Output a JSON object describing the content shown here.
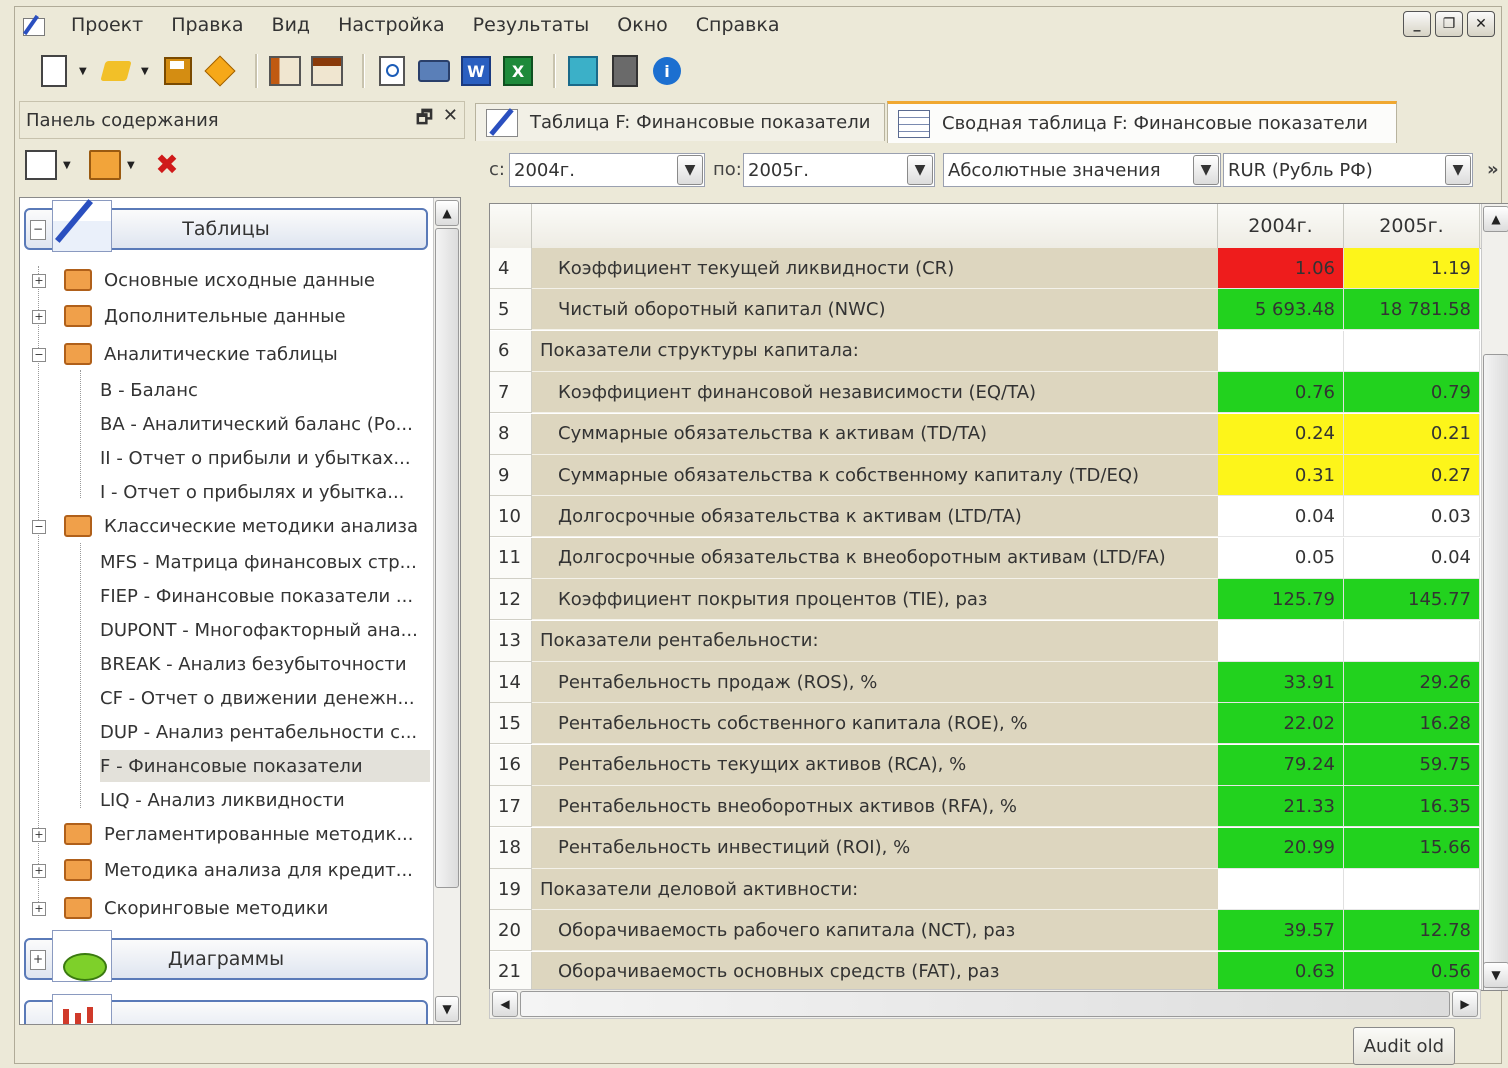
{
  "menu": {
    "items": [
      "Проект",
      "Правка",
      "Вид",
      "Настройка",
      "Результаты",
      "Окно",
      "Справка"
    ]
  },
  "window_controls": [
    "minimize",
    "restore",
    "close"
  ],
  "toolbar": {
    "icons": [
      "new-icon",
      "open-icon",
      "save-icon",
      "diamond-icon",
      "pane-left-icon",
      "pane-top-icon",
      "preview-icon",
      "print-icon",
      "word-icon",
      "excel-icon",
      "export-icon",
      "calculator-icon",
      "info-icon"
    ],
    "word_glyph": "W",
    "excel_glyph": "X",
    "info_glyph": "i"
  },
  "left_panel": {
    "title": "Панель содержания",
    "groups": {
      "tables": "Таблицы",
      "charts": "Диаграммы"
    },
    "folders": {
      "f1": "Основные исходные данные",
      "f2": "Дополнительные данные",
      "f3": "Аналитические таблицы",
      "f4": "Классические методики анализа",
      "f5": "Регламентированные методик...",
      "f6": "Методика анализа для кредит...",
      "f7": "Скоринговые методики"
    },
    "leaves": {
      "a1": "B - Баланс",
      "a2": "BA - Аналитический баланс (Ро...",
      "a3": "II - Отчет о прибыли и убытках...",
      "a4": "I - Отчет о прибылях и убытка...",
      "c1": "MFS - Матрица финансовых стр...",
      "c2": "FIEP - Финансовые показатели ...",
      "c3": "DUPONT - Многофакторный ана...",
      "c4": "BREAK - Анализ безубыточности",
      "c5": "CF - Отчет о движении денежн...",
      "c6": "DUP - Анализ рентабельности с...",
      "c7": "F - Финансовые показатели",
      "c8": "LIQ - Анализ ликвидности"
    }
  },
  "tabs": {
    "tab1": "Таблица F: Финансовые показатели",
    "tab2": "Сводная таблица F: Финансовые показатели"
  },
  "filters": {
    "from_label": "с:",
    "from_value": "2004г.",
    "to_label": "по:",
    "to_value": "2005г.",
    "mode": "Абсолютные значения",
    "currency": "RUR (Рубль РФ)",
    "more": "»"
  },
  "grid": {
    "columns": [
      "",
      "",
      "2004г.",
      "2005г."
    ],
    "rows": [
      {
        "n": "4",
        "name": "Коэффициент текущей ликвидности (CR)",
        "indent": true,
        "v1": "1.06",
        "v2": "1.19",
        "c1": "#ee1c1c",
        "c2": "#fdf51a"
      },
      {
        "n": "5",
        "name": "Чистый оборотный капитал (NWC)",
        "indent": true,
        "v1": "5 693.48",
        "v2": "18 781.58",
        "c1": "#22d21e",
        "c2": "#22d21e"
      },
      {
        "n": "6",
        "name": "Показатели структуры капитала:",
        "indent": false,
        "v1": "",
        "v2": "",
        "c1": "#ffffff",
        "c2": "#ffffff"
      },
      {
        "n": "7",
        "name": "Коэффициент финансовой независимости (EQ/TA)",
        "indent": true,
        "v1": "0.76",
        "v2": "0.79",
        "c1": "#22d21e",
        "c2": "#22d21e"
      },
      {
        "n": "8",
        "name": "Суммарные обязательства к активам (TD/TA)",
        "indent": true,
        "v1": "0.24",
        "v2": "0.21",
        "c1": "#fdf51a",
        "c2": "#fdf51a"
      },
      {
        "n": "9",
        "name": "Суммарные обязательства к собственному капиталу (TD/EQ)",
        "indent": true,
        "v1": "0.31",
        "v2": "0.27",
        "c1": "#fdf51a",
        "c2": "#fdf51a"
      },
      {
        "n": "10",
        "name": "Долгосрочные обязательства к активам (LTD/TA)",
        "indent": true,
        "v1": "0.04",
        "v2": "0.03",
        "c1": "#ffffff",
        "c2": "#ffffff"
      },
      {
        "n": "11",
        "name": "Долгосрочные обязательства к внеоборотным активам (LTD/FA)",
        "indent": true,
        "v1": "0.05",
        "v2": "0.04",
        "c1": "#ffffff",
        "c2": "#ffffff"
      },
      {
        "n": "12",
        "name": "Коэффициент покрытия процентов (TIE), раз",
        "indent": true,
        "v1": "125.79",
        "v2": "145.77",
        "c1": "#22d21e",
        "c2": "#22d21e"
      },
      {
        "n": "13",
        "name": "Показатели рентабельности:",
        "indent": false,
        "v1": "",
        "v2": "",
        "c1": "#ffffff",
        "c2": "#ffffff"
      },
      {
        "n": "14",
        "name": "Рентабельность продаж (ROS), %",
        "indent": true,
        "v1": "33.91",
        "v2": "29.26",
        "c1": "#22d21e",
        "c2": "#22d21e"
      },
      {
        "n": "15",
        "name": "Рентабельность собственного капитала (ROE), %",
        "indent": true,
        "v1": "22.02",
        "v2": "16.28",
        "c1": "#22d21e",
        "c2": "#22d21e"
      },
      {
        "n": "16",
        "name": "Рентабельность текущих активов (RCA), %",
        "indent": true,
        "v1": "79.24",
        "v2": "59.75",
        "c1": "#22d21e",
        "c2": "#22d21e"
      },
      {
        "n": "17",
        "name": "Рентабельность внеоборотных активов (RFA), %",
        "indent": true,
        "v1": "21.33",
        "v2": "16.35",
        "c1": "#22d21e",
        "c2": "#22d21e"
      },
      {
        "n": "18",
        "name": "Рентабельность инвестиций (ROI), %",
        "indent": true,
        "v1": "20.99",
        "v2": "15.66",
        "c1": "#22d21e",
        "c2": "#22d21e"
      },
      {
        "n": "19",
        "name": "Показатели деловой активности:",
        "indent": false,
        "v1": "",
        "v2": "",
        "c1": "#ffffff",
        "c2": "#ffffff"
      },
      {
        "n": "20",
        "name": "Оборачиваемость рабочего капитала (NCT), раз",
        "indent": true,
        "v1": "39.57",
        "v2": "12.78",
        "c1": "#22d21e",
        "c2": "#22d21e"
      },
      {
        "n": "21",
        "name": "Оборачиваемость основных средств (FAT), раз",
        "indent": true,
        "v1": "0.63",
        "v2": "0.56",
        "c1": "#22d21e",
        "c2": "#22d21e"
      }
    ]
  },
  "status": {
    "audit_button": "Audit old"
  }
}
